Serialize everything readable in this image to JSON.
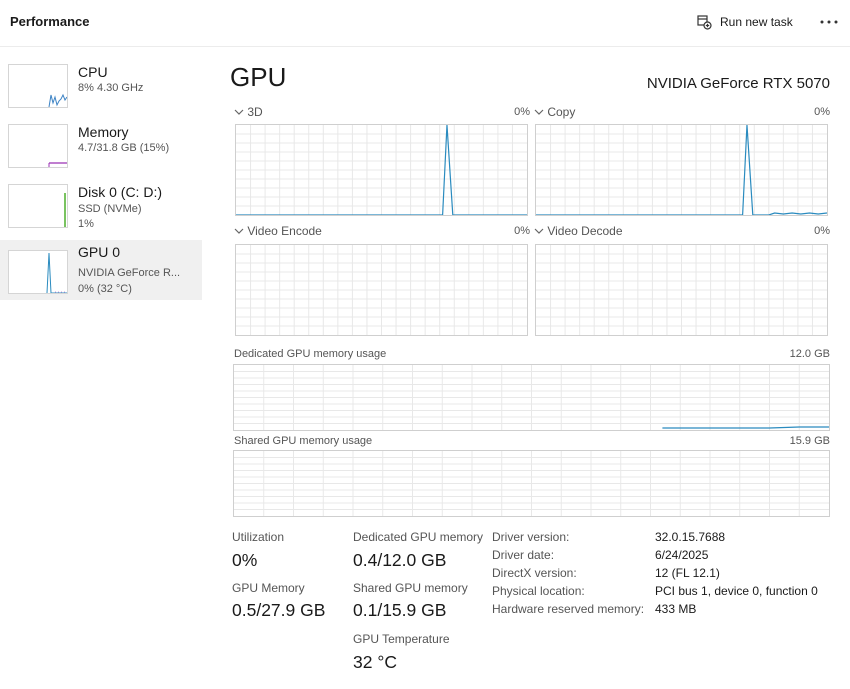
{
  "header": {
    "title": "Performance",
    "run_task_label": "Run new task",
    "run_task_icon": "run-task-icon",
    "more_icon": "more-options-icon"
  },
  "sidebar": {
    "items": [
      {
        "title": "CPU",
        "sub1": "8% 4.30 GHz",
        "sub2": "",
        "sub3": "",
        "color": "#3b82c4"
      },
      {
        "title": "Memory",
        "sub1": "4.7/31.8 GB (15%)",
        "sub2": "",
        "sub3": "",
        "color": "#9b30b5"
      },
      {
        "title": "Disk 0 (C: D:)",
        "sub1": "SSD (NVMe)",
        "sub2": "1%",
        "sub3": "",
        "color": "#4caf2a"
      },
      {
        "title": "GPU 0",
        "sub1": "NVIDIA GeForce R...",
        "sub2": "0%  (32 °C)",
        "sub3": "",
        "color": "#2a8bbf"
      }
    ]
  },
  "main": {
    "title": "GPU",
    "gpu_name": "NVIDIA GeForce RTX 5070",
    "graphs": [
      {
        "label": "3D",
        "percent": "0%"
      },
      {
        "label": "Copy",
        "percent": "0%"
      },
      {
        "label": "Video Encode",
        "percent": "0%"
      },
      {
        "label": "Video Decode",
        "percent": "0%"
      }
    ],
    "dedicated_label": "Dedicated GPU memory usage",
    "dedicated_max": "12.0 GB",
    "shared_label": "Shared GPU memory usage",
    "shared_max": "15.9 GB",
    "stats": {
      "utilization_label": "Utilization",
      "utilization_value": "0%",
      "dedicated_label": "Dedicated GPU memory",
      "dedicated_value": "0.4/12.0 GB",
      "gpu_memory_label": "GPU Memory",
      "gpu_memory_value": "0.5/27.9 GB",
      "shared_label": "Shared GPU memory",
      "shared_value": "0.1/15.9 GB",
      "temp_label": "GPU Temperature",
      "temp_value": "32 °C"
    },
    "info": [
      {
        "key": "Driver version:",
        "value": "32.0.15.7688"
      },
      {
        "key": "Driver date:",
        "value": "6/24/2025"
      },
      {
        "key": "DirectX version:",
        "value": "12 (FL 12.1)"
      },
      {
        "key": "Physical location:",
        "value": "PCI bus 1, device 0, function 0"
      },
      {
        "key": "Hardware reserved memory:",
        "value": "433 MB"
      }
    ]
  },
  "colors": {
    "graph_line": "#2a8bbf",
    "grid": "#e8e8e8",
    "sel_bg": "#f0f0f0"
  }
}
